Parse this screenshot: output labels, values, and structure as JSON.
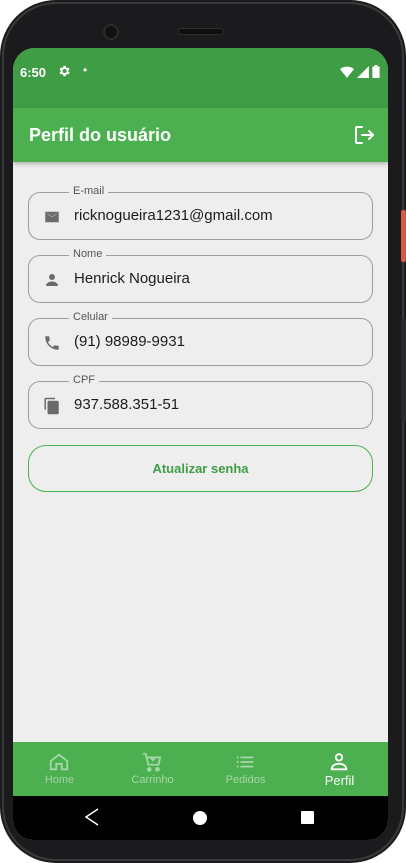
{
  "status_bar": {
    "time": "6:50",
    "gear_icon": "gear-icon",
    "dot": "•"
  },
  "app_bar": {
    "title": "Perfil do usuário",
    "logout_icon": "logout-icon"
  },
  "fields": [
    {
      "label": "E-mail",
      "value": "ricknogueira1231@gmail.com",
      "icon": "mail-icon"
    },
    {
      "label": "Nome",
      "value": "Henrick Nogueira",
      "icon": "person-icon"
    },
    {
      "label": "Celular",
      "value": "(91) 98989-9931",
      "icon": "phone-icon"
    },
    {
      "label": "CPF",
      "value": "937.588.351-51",
      "icon": "document-copy-icon"
    }
  ],
  "update_password_button": "Atualizar senha",
  "bottom_nav": [
    {
      "label": "Home",
      "icon": "home-icon",
      "active": false
    },
    {
      "label": "Carrinho",
      "icon": "cart-icon",
      "active": false
    },
    {
      "label": "Pedidos",
      "icon": "list-icon",
      "active": false
    },
    {
      "label": "Perfil",
      "icon": "person-outline-icon",
      "active": true
    }
  ],
  "colors": {
    "primary": "#4caf50",
    "status_bar": "#3f9d45",
    "inactive_nav": "#a5d6a7",
    "background": "#eeeeee"
  }
}
